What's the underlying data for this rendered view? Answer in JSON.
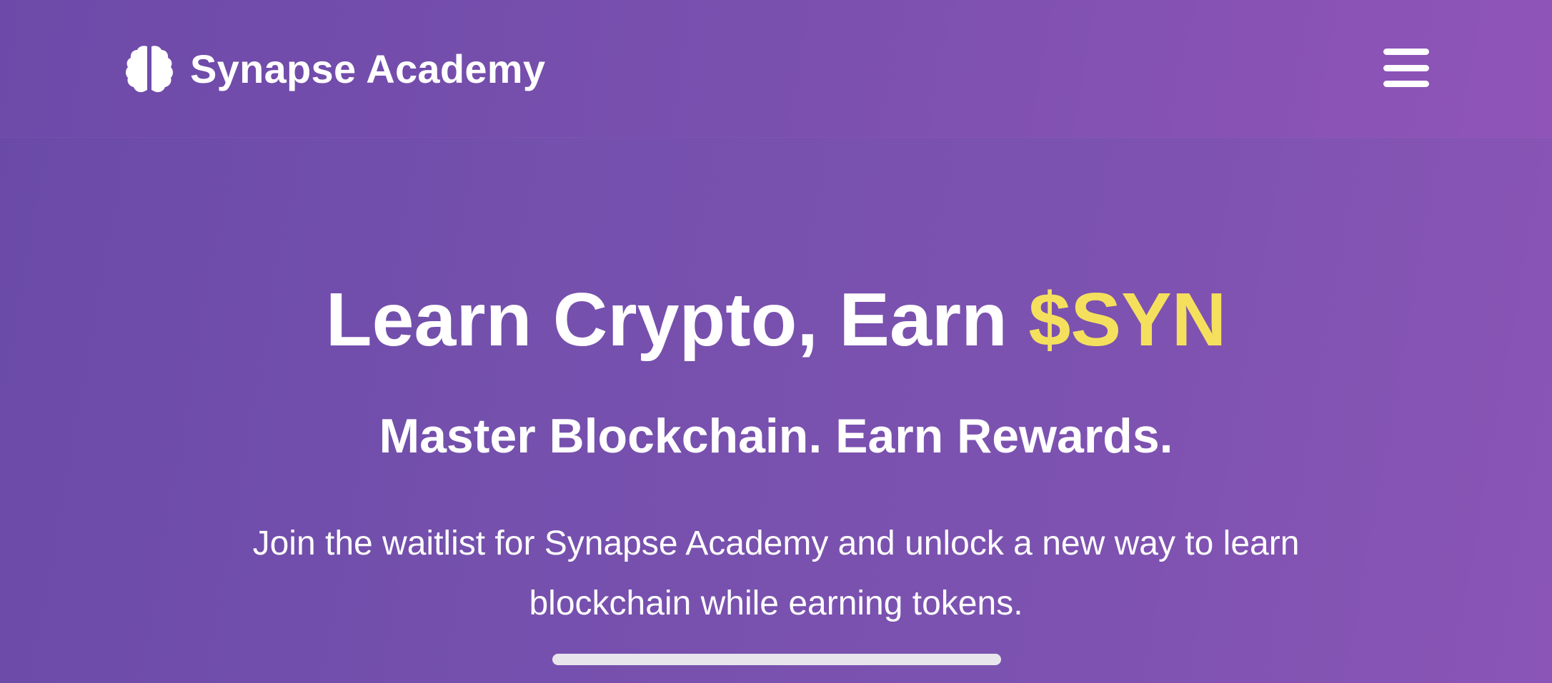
{
  "header": {
    "brand_name": "Synapse Academy",
    "brand_icon": "brain-icon",
    "menu_icon": "hamburger-menu-icon"
  },
  "hero": {
    "title_main": "Learn Crypto, Earn ",
    "title_accent": "$SYN",
    "subtitle": "Master Blockchain. Earn Rewards.",
    "body": "Join the waitlist for Synapse Academy and unlock a new way to learn blockchain while earning tokens."
  },
  "colors": {
    "accent": "#f5e05e",
    "background_start": "#6a4aa8",
    "background_end": "#8a55b6",
    "text": "#ffffff"
  }
}
